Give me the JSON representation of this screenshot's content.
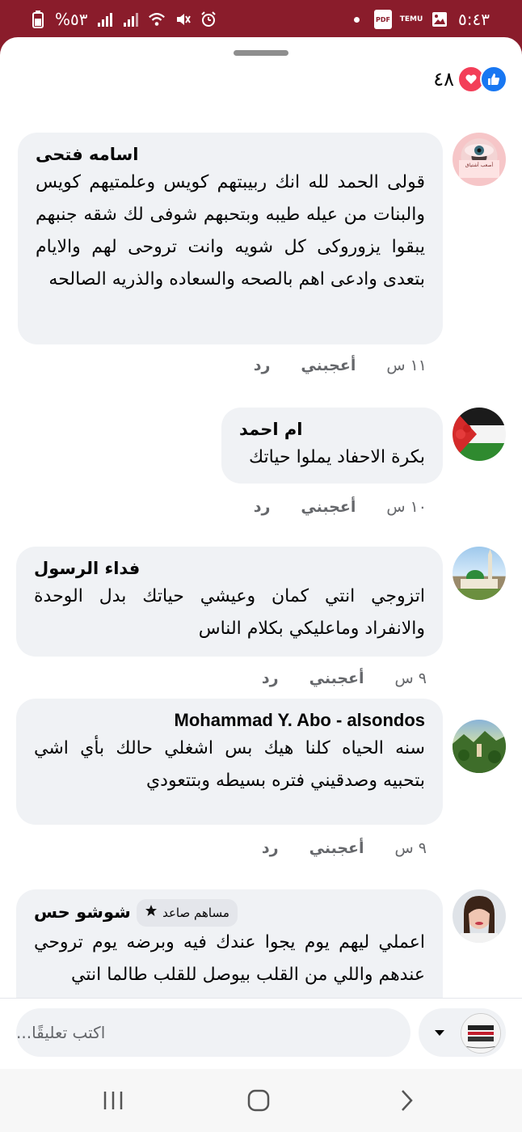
{
  "status_bar": {
    "time": "٥:٤٣",
    "battery": "%٥٣",
    "notification_icons": [
      "pdf-icon",
      "temu-icon",
      "gallery-icon",
      "dot"
    ],
    "system_icons": [
      "battery-icon",
      "signal-icon",
      "signal-icon",
      "wifi-icon",
      "mute-icon",
      "alarm-icon"
    ],
    "temu_label": "TEMU",
    "pdf_label": "PDF"
  },
  "reactions": {
    "count": "٤٨",
    "types": [
      "like",
      "love"
    ]
  },
  "comments": [
    {
      "author": "اسامه فتحى",
      "text": "قولى الحمد لله انك ربيبتهم كويس وعلمتيهم كويس والبنات من عيله طيبه وبتحبهم شوفى لك شقه جنبهم يبقوا يزوروكى كل شويه وانت تروحى لهم والايام بتعدى وادعى اهم بالصحه والسعاده والذريه الصالحه",
      "time": "١١ س",
      "like_label": "أعجبني",
      "reply_label": "رد"
    },
    {
      "author": "ام احمد",
      "text": "بكرة الاحفاد يملوا حياتك",
      "time": "١٠ س",
      "like_label": "أعجبني",
      "reply_label": "رد"
    },
    {
      "author": "فداء الرسول",
      "text": "اتزوجي انتي كمان وعيشي حياتك بدل الوحدة والانفراد وماعليكي بكلام الناس",
      "time": "٩ س",
      "like_label": "أعجبني",
      "reply_label": "رد"
    },
    {
      "author": "Mohammad Y. Abo - alsondos",
      "text": "سنه الحياه  كلنا هيك بس اشغلي حالك بأي اشي بتحبيه وصدقيني فتره بسيطه وبتتعودي",
      "time": "٩ س",
      "like_label": "أعجبني",
      "reply_label": "رد"
    },
    {
      "author": "شوشو حس",
      "badge": "مساهم صاعد",
      "text": "اعملي ليهم يوم يجوا عندك فيه وبرضه يوم تروحي عندهم واللي من القلب بيوصل للقلب طالما انتي"
    }
  ],
  "composer": {
    "placeholder": "اكتب تعليقًا..."
  },
  "colors": {
    "status_bar": "#8a1c2b",
    "bubble": "#f0f2f5",
    "like": "#1877f2",
    "love": "#f33e58"
  }
}
